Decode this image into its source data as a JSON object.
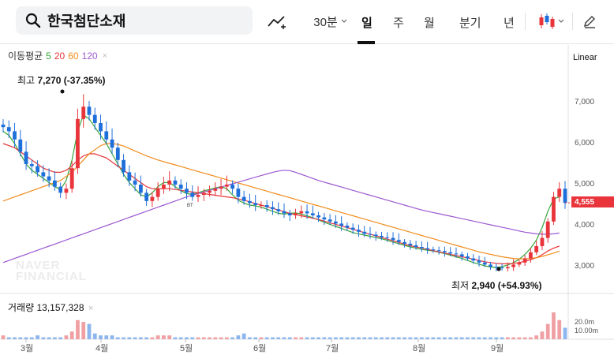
{
  "search": {
    "query": "한국첨단소재"
  },
  "toolbar": {
    "interval_30m": "30분",
    "tabs": [
      "일",
      "주",
      "월",
      "분기",
      "년"
    ],
    "active_tab": "일"
  },
  "chart": {
    "ma_title": "이동평균",
    "ma_periods": [
      {
        "label": "5",
        "color": "#3aa53a"
      },
      {
        "label": "20",
        "color": "#e8343a"
      },
      {
        "label": "60",
        "color": "#f08c1e"
      },
      {
        "label": "120",
        "color": "#9b59d0"
      }
    ],
    "scale": "Linear",
    "current_price": "4,555",
    "high_label": "최고",
    "high_value": "7,270 (-37.35%)",
    "low_label": "최저",
    "low_value": "2,940 (+54.93%)",
    "volume_title": "거래량",
    "volume_value": "13,157,328",
    "volume_ticks": [
      "20.0m",
      "10.00m"
    ],
    "marker_label": "BT",
    "watermark_lines": [
      "NAVER",
      "FINANCIAL"
    ],
    "up_color": "#e8343a",
    "down_color": "#1e6fd9"
  },
  "chart_data": {
    "type": "candlestick",
    "y_ticks": [
      7000,
      6000,
      5000,
      4000,
      3000
    ],
    "ylim": [
      2500,
      7800
    ],
    "x_labels": [
      "3월",
      "4월",
      "5월",
      "6월",
      "7월",
      "8월",
      "9월"
    ],
    "high": 7270,
    "low": 2940,
    "last": 4555,
    "close_series": [
      6400,
      6300,
      6100,
      5800,
      5500,
      5450,
      5300,
      5200,
      5100,
      4950,
      4800,
      4900,
      5400,
      6600,
      6900,
      6700,
      6500,
      6300,
      6100,
      5900,
      5600,
      5300,
      5100,
      5000,
      4800,
      4600,
      4700,
      4900,
      5000,
      5100,
      5000,
      4900,
      4800,
      4700,
      4750,
      4800,
      4850,
      4900,
      4950,
      5000,
      4900,
      4700,
      4600,
      4550,
      4500,
      4500,
      4450,
      4400,
      4350,
      4300,
      4250,
      4300,
      4350,
      4300,
      4250,
      4200,
      4150,
      4100,
      4050,
      4000,
      3950,
      3900,
      3850,
      3800,
      3780,
      3750,
      3720,
      3700,
      3650,
      3600,
      3560,
      3520,
      3480,
      3450,
      3420,
      3400,
      3380,
      3350,
      3320,
      3300,
      3250,
      3200,
      3150,
      3100,
      3050,
      3000,
      2980,
      2960,
      2990,
      3050,
      3100,
      3200,
      3350,
      3500,
      3700,
      4100,
      4700,
      4900,
      4555
    ],
    "ma_series": [
      {
        "name": "5",
        "values": [
          6300,
          6200,
          6000,
          5750,
          5500,
          5350,
          5250,
          5150,
          5050,
          4950,
          4880,
          5100,
          5600,
          6300,
          6700,
          6600,
          6400,
          6200,
          6000,
          5750,
          5500,
          5250,
          5050,
          4900,
          4750,
          4700,
          4800,
          4950,
          5050,
          5050,
          4950,
          4850,
          4780,
          4760,
          4800,
          4850,
          4880,
          4920,
          4950,
          4900,
          4750,
          4620,
          4550,
          4500,
          4480,
          4450,
          4400,
          4350,
          4300,
          4280,
          4300,
          4310,
          4280,
          4240,
          4190,
          4140,
          4080,
          4030,
          3980,
          3930,
          3880,
          3830,
          3800,
          3770,
          3740,
          3710,
          3680,
          3640,
          3600,
          3560,
          3520,
          3480,
          3450,
          3420,
          3400,
          3380,
          3350,
          3320,
          3280,
          3240,
          3200,
          3150,
          3100,
          3060,
          3020,
          2990,
          2980,
          3000,
          3040,
          3100,
          3180,
          3300,
          3450,
          3650,
          3950,
          4350,
          4650,
          4700
        ]
      },
      {
        "name": "20",
        "values": [
          6000,
          5950,
          5900,
          5800,
          5700,
          5600,
          5500,
          5400,
          5350,
          5300,
          5300,
          5350,
          5450,
          5600,
          5700,
          5750,
          5750,
          5700,
          5650,
          5550,
          5450,
          5350,
          5250,
          5150,
          5050,
          4950,
          4900,
          4900,
          4900,
          4900,
          4880,
          4860,
          4840,
          4820,
          4800,
          4780,
          4760,
          4740,
          4720,
          4700,
          4680,
          4650,
          4620,
          4580,
          4540,
          4500,
          4460,
          4420,
          4380,
          4340,
          4300,
          4270,
          4240,
          4210,
          4180,
          4150,
          4110,
          4070,
          4030,
          3990,
          3950,
          3910,
          3870,
          3830,
          3790,
          3750,
          3710,
          3670,
          3630,
          3590,
          3550,
          3510,
          3480,
          3450,
          3420,
          3390,
          3360,
          3330,
          3300,
          3270,
          3240,
          3210,
          3180,
          3150,
          3120,
          3100,
          3080,
          3070,
          3070,
          3080,
          3100,
          3130,
          3170,
          3220,
          3290,
          3380,
          3450,
          3500
        ]
      },
      {
        "name": "60",
        "values": [
          4600,
          4650,
          4700,
          4750,
          4800,
          4850,
          4900,
          4950,
          5000,
          5050,
          5100,
          5200,
          5300,
          5450,
          5600,
          5750,
          5850,
          5950,
          6000,
          6000,
          5980,
          5940,
          5880,
          5820,
          5760,
          5700,
          5650,
          5600,
          5560,
          5520,
          5480,
          5440,
          5400,
          5360,
          5320,
          5280,
          5240,
          5200,
          5160,
          5120,
          5080,
          5040,
          5000,
          4960,
          4920,
          4880,
          4840,
          4800,
          4760,
          4720,
          4680,
          4640,
          4600,
          4560,
          4520,
          4480,
          4440,
          4400,
          4360,
          4320,
          4280,
          4240,
          4200,
          4160,
          4120,
          4080,
          4040,
          4000,
          3960,
          3920,
          3880,
          3840,
          3800,
          3760,
          3720,
          3680,
          3640,
          3600,
          3560,
          3520,
          3480,
          3440,
          3400,
          3360,
          3330,
          3300,
          3270,
          3240,
          3220,
          3200,
          3190,
          3190,
          3200,
          3220,
          3250,
          3290,
          3330,
          3380
        ]
      },
      {
        "name": "120",
        "values": [
          3100,
          3150,
          3200,
          3250,
          3300,
          3350,
          3400,
          3450,
          3500,
          3550,
          3600,
          3650,
          3700,
          3750,
          3800,
          3850,
          3900,
          3950,
          4000,
          4050,
          4100,
          4150,
          4200,
          4250,
          4300,
          4350,
          4400,
          4450,
          4500,
          4550,
          4600,
          4650,
          4700,
          4740,
          4780,
          4820,
          4860,
          4900,
          4940,
          4980,
          5020,
          5060,
          5100,
          5140,
          5180,
          5220,
          5260,
          5300,
          5330,
          5350,
          5340,
          5300,
          5250,
          5200,
          5150,
          5100,
          5060,
          5020,
          4980,
          4940,
          4900,
          4860,
          4820,
          4780,
          4740,
          4700,
          4660,
          4620,
          4580,
          4540,
          4500,
          4460,
          4420,
          4380,
          4350,
          4320,
          4290,
          4260,
          4230,
          4200,
          4170,
          4140,
          4110,
          4080,
          4050,
          4020,
          3990,
          3960,
          3930,
          3900,
          3870,
          3840,
          3820,
          3800,
          3790,
          3790,
          3800,
          3820
        ]
      }
    ],
    "volume": [
      2,
      1,
      1,
      1,
      1,
      1,
      2,
      1,
      1,
      1,
      1,
      2,
      4,
      10,
      9,
      8,
      3,
      2,
      2,
      2,
      1,
      1,
      1,
      1,
      1,
      1,
      1,
      2,
      2,
      2,
      1,
      1,
      1,
      1,
      1,
      1,
      1,
      1,
      1,
      1,
      1,
      2,
      3,
      1,
      1,
      1,
      1,
      1,
      1,
      1,
      1,
      1,
      1,
      1,
      1,
      1,
      1,
      1,
      1,
      1,
      1,
      1,
      1,
      1,
      1,
      1,
      1,
      1,
      1,
      1,
      1,
      1,
      1,
      1,
      1,
      1,
      1,
      1,
      1,
      1,
      1,
      1,
      1,
      1,
      1,
      1,
      1,
      1,
      1,
      1,
      1,
      1,
      1,
      2,
      4,
      8,
      14,
      10,
      6
    ]
  }
}
